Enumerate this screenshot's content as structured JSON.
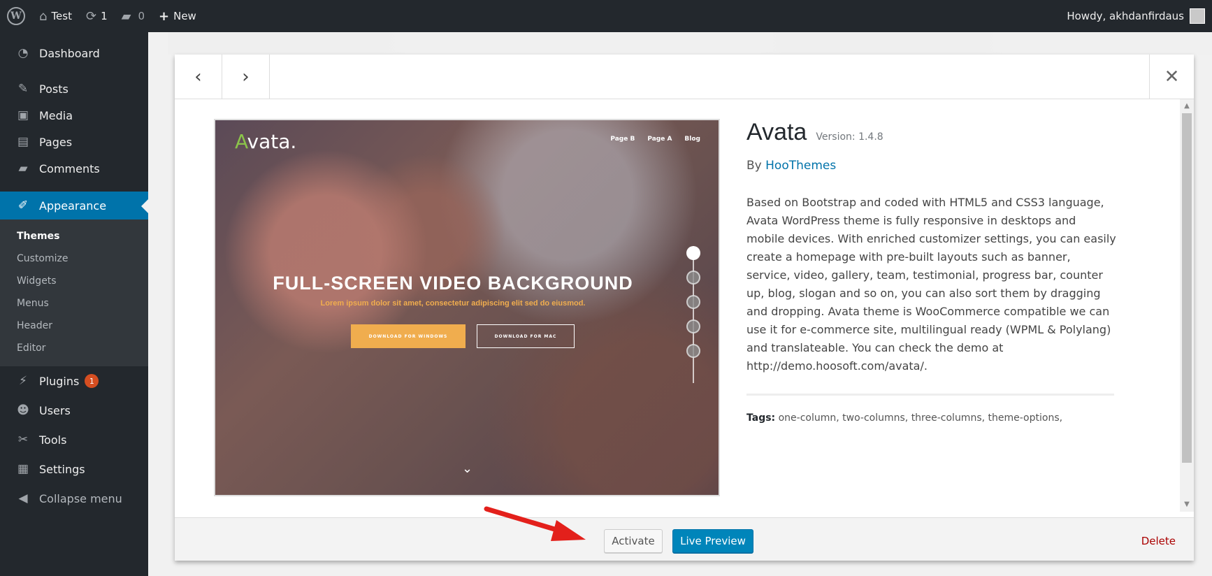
{
  "adminbar": {
    "site_name": "Test",
    "updates_count": "1",
    "comments_count": "0",
    "new_label": "New",
    "howdy": "Howdy, akhdanfirdaus"
  },
  "sidebar": {
    "items": [
      {
        "label": "Dashboard",
        "icon": "dashboard-icon"
      },
      {
        "label": "Posts",
        "icon": "pin-icon"
      },
      {
        "label": "Media",
        "icon": "media-icon"
      },
      {
        "label": "Pages",
        "icon": "page-icon"
      },
      {
        "label": "Comments",
        "icon": "comment-icon"
      },
      {
        "label": "Appearance",
        "icon": "brush-icon"
      },
      {
        "label": "Plugins",
        "icon": "plugin-icon",
        "badge": "1"
      },
      {
        "label": "Users",
        "icon": "users-icon"
      },
      {
        "label": "Tools",
        "icon": "wrench-icon"
      },
      {
        "label": "Settings",
        "icon": "settings-icon"
      },
      {
        "label": "Collapse menu",
        "icon": "collapse-icon"
      }
    ],
    "submenu": [
      "Themes",
      "Customize",
      "Widgets",
      "Menus",
      "Header",
      "Editor"
    ]
  },
  "theme": {
    "name": "Avata",
    "version": "Version: 1.4.8",
    "by": "By",
    "author": "HooThemes",
    "description": "Based on Bootstrap and coded with HTML5 and CSS3 language, Avata WordPress theme is fully responsive in desktops and mobile devices. With enriched customizer settings, you can easily create a homepage with pre-built layouts such as banner, service, video, gallery, team, testimonial, progress bar, counter up, blog, slogan and so on, you can also sort them by dragging and dropping. Avata theme is WooCommerce compatible we can use it for e-commerce site, multilingual ready (WPML & Polylang) and translateable. You can check the demo at http://demo.hoosoft.com/avata/.",
    "tags_label": "Tags:",
    "tags": "one-column, two-columns, three-columns, theme-options,"
  },
  "screenshot": {
    "logo_a": "A",
    "logo_rest": "vata.",
    "nav": [
      "Page B",
      "Page A",
      "Blog"
    ],
    "headline": "FULL-SCREEN VIDEO BACKGROUND",
    "subline": "Lorem ipsum dolor sit amet, consectetur adipiscing elit sed do eiusmod.",
    "btn_windows": "DOWNLOAD FOR WINDOWS",
    "btn_mac": "DOWNLOAD FOR MAC"
  },
  "footer": {
    "activate": "Activate",
    "live_preview": "Live Preview",
    "delete": "Delete"
  },
  "colors": {
    "primary": "#0085ba",
    "admin_dark": "#23282d",
    "delete": "#a00",
    "annotation_arrow": "#e3201b"
  }
}
